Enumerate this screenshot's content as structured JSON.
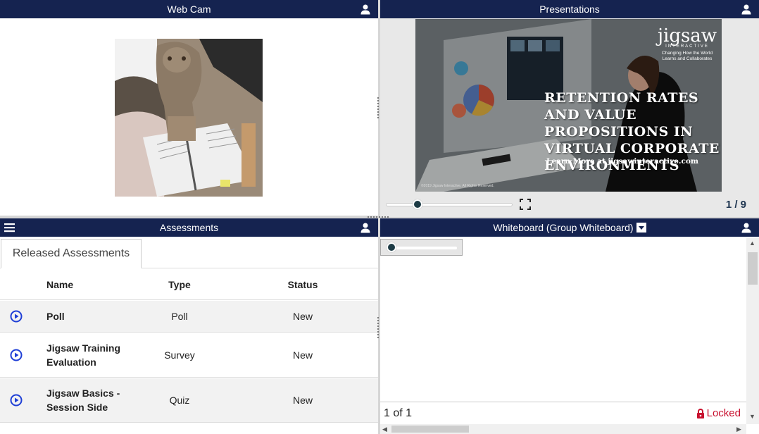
{
  "webcam": {
    "title": "Web Cam"
  },
  "presentations": {
    "title": "Presentations",
    "slide_title": "RETENTION RATES AND VALUE PROPOSITIONS IN VIRTUAL CORPORATE ENVIRONMENTS",
    "slide_link": "Learn More at jigsawinteractive.com",
    "brand_logo": "jigsaw",
    "brand_sub": "INTERACTIVE",
    "brand_tagline": "Changing How the World Learns and Collaborates",
    "slide_copyright": "©2019 Jigsaw Interactive. All Rights Reserved.",
    "page_indicator": "1 / 9",
    "progress": 0.22
  },
  "assessments": {
    "title": "Assessments",
    "tab_label": "Released Assessments",
    "columns": {
      "name": "Name",
      "type": "Type",
      "status": "Status"
    },
    "rows": [
      {
        "name": "Poll",
        "type": "Poll",
        "status": "New"
      },
      {
        "name": "Jigsaw Training Evaluation",
        "type": "Survey",
        "status": "New"
      },
      {
        "name": "Jigsaw Basics - Session Side",
        "type": "Quiz",
        "status": "New"
      }
    ]
  },
  "whiteboard": {
    "title": "Whiteboard (Group Whiteboard)",
    "page_indicator": "1 of 1",
    "lock_label": "Locked"
  },
  "colors": {
    "header_bg": "#152350",
    "accent_blue": "#1f3fd6",
    "locked_red": "#c8102e"
  }
}
